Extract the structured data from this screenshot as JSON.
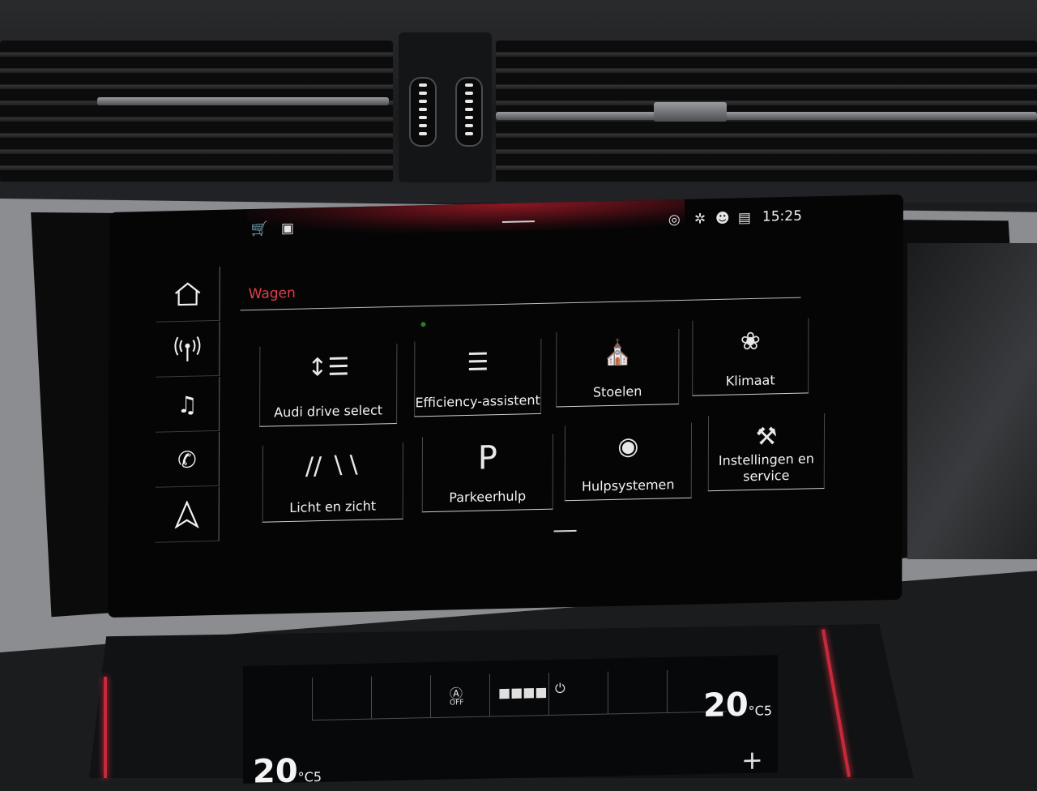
{
  "statusbar": {
    "left_icons": [
      "cart-icon",
      "package-icon"
    ],
    "right_icons": [
      "location-icon",
      "bluetooth-icon",
      "person-icon",
      "signal-icon"
    ],
    "time": "15:25"
  },
  "sidebar": {
    "items": [
      {
        "name": "home",
        "icon": "home-icon"
      },
      {
        "name": "radio",
        "icon": "antenna-icon"
      },
      {
        "name": "media",
        "icon": "music-note-icon"
      },
      {
        "name": "phone",
        "icon": "phone-icon"
      },
      {
        "name": "navigation",
        "icon": "navigation-arrow-icon"
      }
    ]
  },
  "section_title": "Wagen",
  "tiles": [
    {
      "name": "audi-drive-select",
      "label": "Audi drive select",
      "icon": "suspension-icon"
    },
    {
      "name": "efficiency-assistent",
      "label": "Efficiency-assistent",
      "icon": "efficiency-bars-icon"
    },
    {
      "name": "stoelen",
      "label": "Stoelen",
      "icon": "seat-icon"
    },
    {
      "name": "klimaat",
      "label": "Klimaat",
      "icon": "fan-icon"
    },
    {
      "name": "licht-en-zicht",
      "label": "Licht en zicht",
      "icon": "road-light-icon"
    },
    {
      "name": "parkeerhulp",
      "label": "Parkeerhulp",
      "icon": "parking-icon"
    },
    {
      "name": "hulpsystemen",
      "label": "Hulpsystemen",
      "icon": "car-sensor-icon"
    },
    {
      "name": "instellingen-en-service",
      "label": "Instellingen en service",
      "icon": "tools-icon"
    }
  ],
  "climate": {
    "left_temp": "20",
    "left_temp_unit": "°C",
    "left_temp_decimal": "5",
    "right_temp": "20",
    "right_temp_unit": "°C",
    "right_temp_decimal": "5",
    "auto_off_label": "OFF",
    "plus_label": "+"
  },
  "colors": {
    "accent": "#e0404a",
    "text": "#f3f3f3",
    "screen_bg": "#050506"
  }
}
